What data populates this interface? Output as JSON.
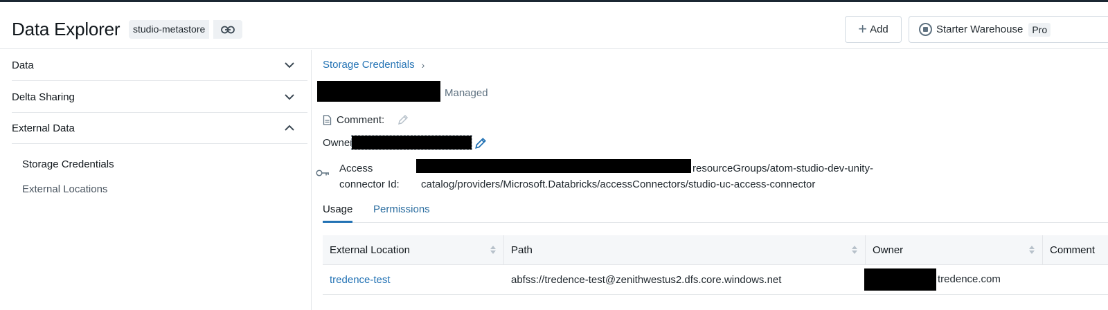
{
  "header": {
    "title": "Data Explorer",
    "metastore": "studio-metastore",
    "add_label": "Add",
    "warehouse_name": "Starter Warehouse",
    "warehouse_tier": "Pro"
  },
  "sidebar": {
    "sections": [
      {
        "label": "Data",
        "expanded": false
      },
      {
        "label": "Delta Sharing",
        "expanded": false
      },
      {
        "label": "External Data",
        "expanded": true
      }
    ],
    "sub_items": [
      {
        "label": "Storage Credentials",
        "active": true
      },
      {
        "label": "External Locations",
        "active": false
      }
    ]
  },
  "main": {
    "breadcrumb": "Storage Credentials",
    "credential_type": "Managed",
    "comment_label": "Comment:",
    "owner_label": "Owner:",
    "access_connector_label": "Access connector Id:",
    "access_connector_value_line1": "resourceGroups/atom-studio-dev-unity-",
    "access_connector_value_line2": "catalog/providers/Microsoft.Databricks/accessConnectors/studio-uc-access-connector",
    "tabs": [
      {
        "label": "Usage",
        "active": true
      },
      {
        "label": "Permissions",
        "active": false
      }
    ],
    "table": {
      "columns": [
        "External Location",
        "Path",
        "Owner",
        "Comment"
      ],
      "rows": [
        {
          "external_location": "tredence-test",
          "path": "abfss://tredence-test@zenithwestus2.dfs.core.windows.net",
          "owner_suffix": "tredence.com",
          "comment": ""
        }
      ]
    }
  },
  "colors": {
    "link": "#2272b4",
    "border": "#e3e6e9",
    "header_bg": "#f5f7f9",
    "redaction": "#000000"
  }
}
